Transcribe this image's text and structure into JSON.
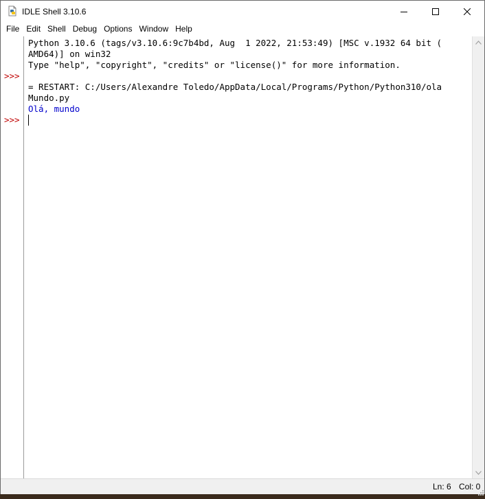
{
  "window": {
    "title": "IDLE Shell 3.10.6",
    "icon": "python-idle-icon"
  },
  "menu": [
    "File",
    "Edit",
    "Shell",
    "Debug",
    "Options",
    "Window",
    "Help"
  ],
  "shell": {
    "prompt": ">>>",
    "lines": [
      "Python 3.10.6 (tags/v3.10.6:9c7b4bd, Aug  1 2022, 21:53:49) [MSC v.1932 64 bit (",
      "AMD64)] on win32",
      "Type \"help\", \"copyright\", \"credits\" or \"license()\" for more information.",
      "",
      "= RESTART: C:/Users/Alexandre Toledo/AppData/Local/Programs/Python/Python310/ola",
      "Mundo.py",
      "Olá, mundo"
    ]
  },
  "status": {
    "ln": "Ln: 6",
    "col": "Col: 0"
  },
  "colors": {
    "prompt": "#c00000",
    "stdout": "#0000cc"
  }
}
